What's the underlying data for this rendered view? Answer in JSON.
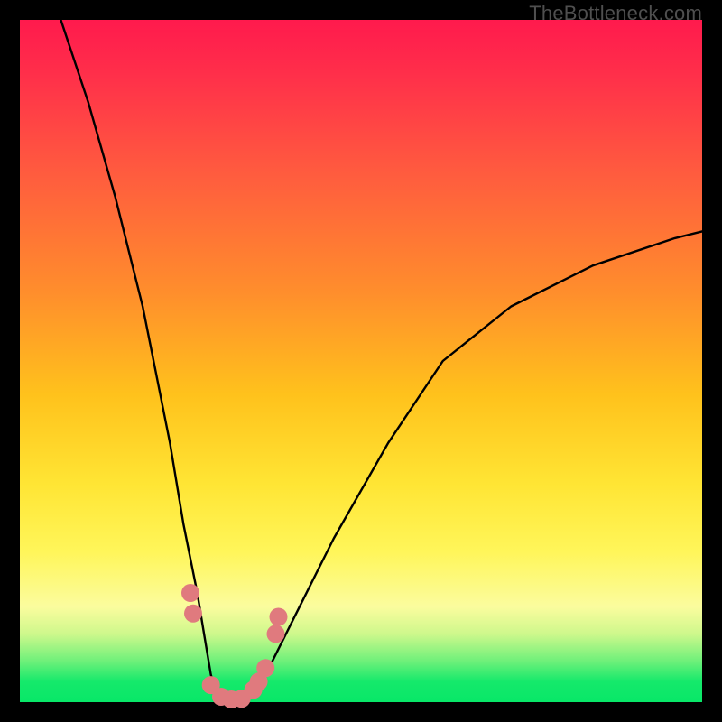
{
  "attribution": "TheBottleneck.com",
  "chart_data": {
    "type": "line",
    "title": "",
    "xlabel": "",
    "ylabel": "",
    "xlim": [
      0,
      100
    ],
    "ylim": [
      0,
      100
    ],
    "series": [
      {
        "name": "bottleneck-curve",
        "x": [
          6,
          10,
          14,
          18,
          22,
          24,
          26,
          27,
          28,
          29,
          30,
          32,
          34,
          36,
          40,
          46,
          54,
          62,
          72,
          84,
          96,
          100
        ],
        "values": [
          100,
          88,
          74,
          58,
          38,
          26,
          16,
          10,
          4,
          1,
          0,
          0,
          1,
          4,
          12,
          24,
          38,
          50,
          58,
          64,
          68,
          69
        ]
      }
    ],
    "markers": {
      "name": "highlight-dots",
      "color": "#e07a7e",
      "points_xy": [
        [
          25.0,
          16
        ],
        [
          25.4,
          13
        ],
        [
          28.0,
          2.5
        ],
        [
          29.5,
          0.8
        ],
        [
          31.0,
          0.4
        ],
        [
          32.5,
          0.5
        ],
        [
          34.2,
          1.8
        ],
        [
          35.0,
          3.0
        ],
        [
          36.0,
          5.0
        ],
        [
          37.5,
          10.0
        ],
        [
          37.9,
          12.5
        ]
      ]
    },
    "background_gradient_stops": [
      {
        "pos": 0.0,
        "color": "#ff1a4d"
      },
      {
        "pos": 0.4,
        "color": "#ff8e2c"
      },
      {
        "pos": 0.68,
        "color": "#ffe534"
      },
      {
        "pos": 0.88,
        "color": "#fbfc9e"
      },
      {
        "pos": 1.0,
        "color": "#08e768"
      }
    ]
  }
}
